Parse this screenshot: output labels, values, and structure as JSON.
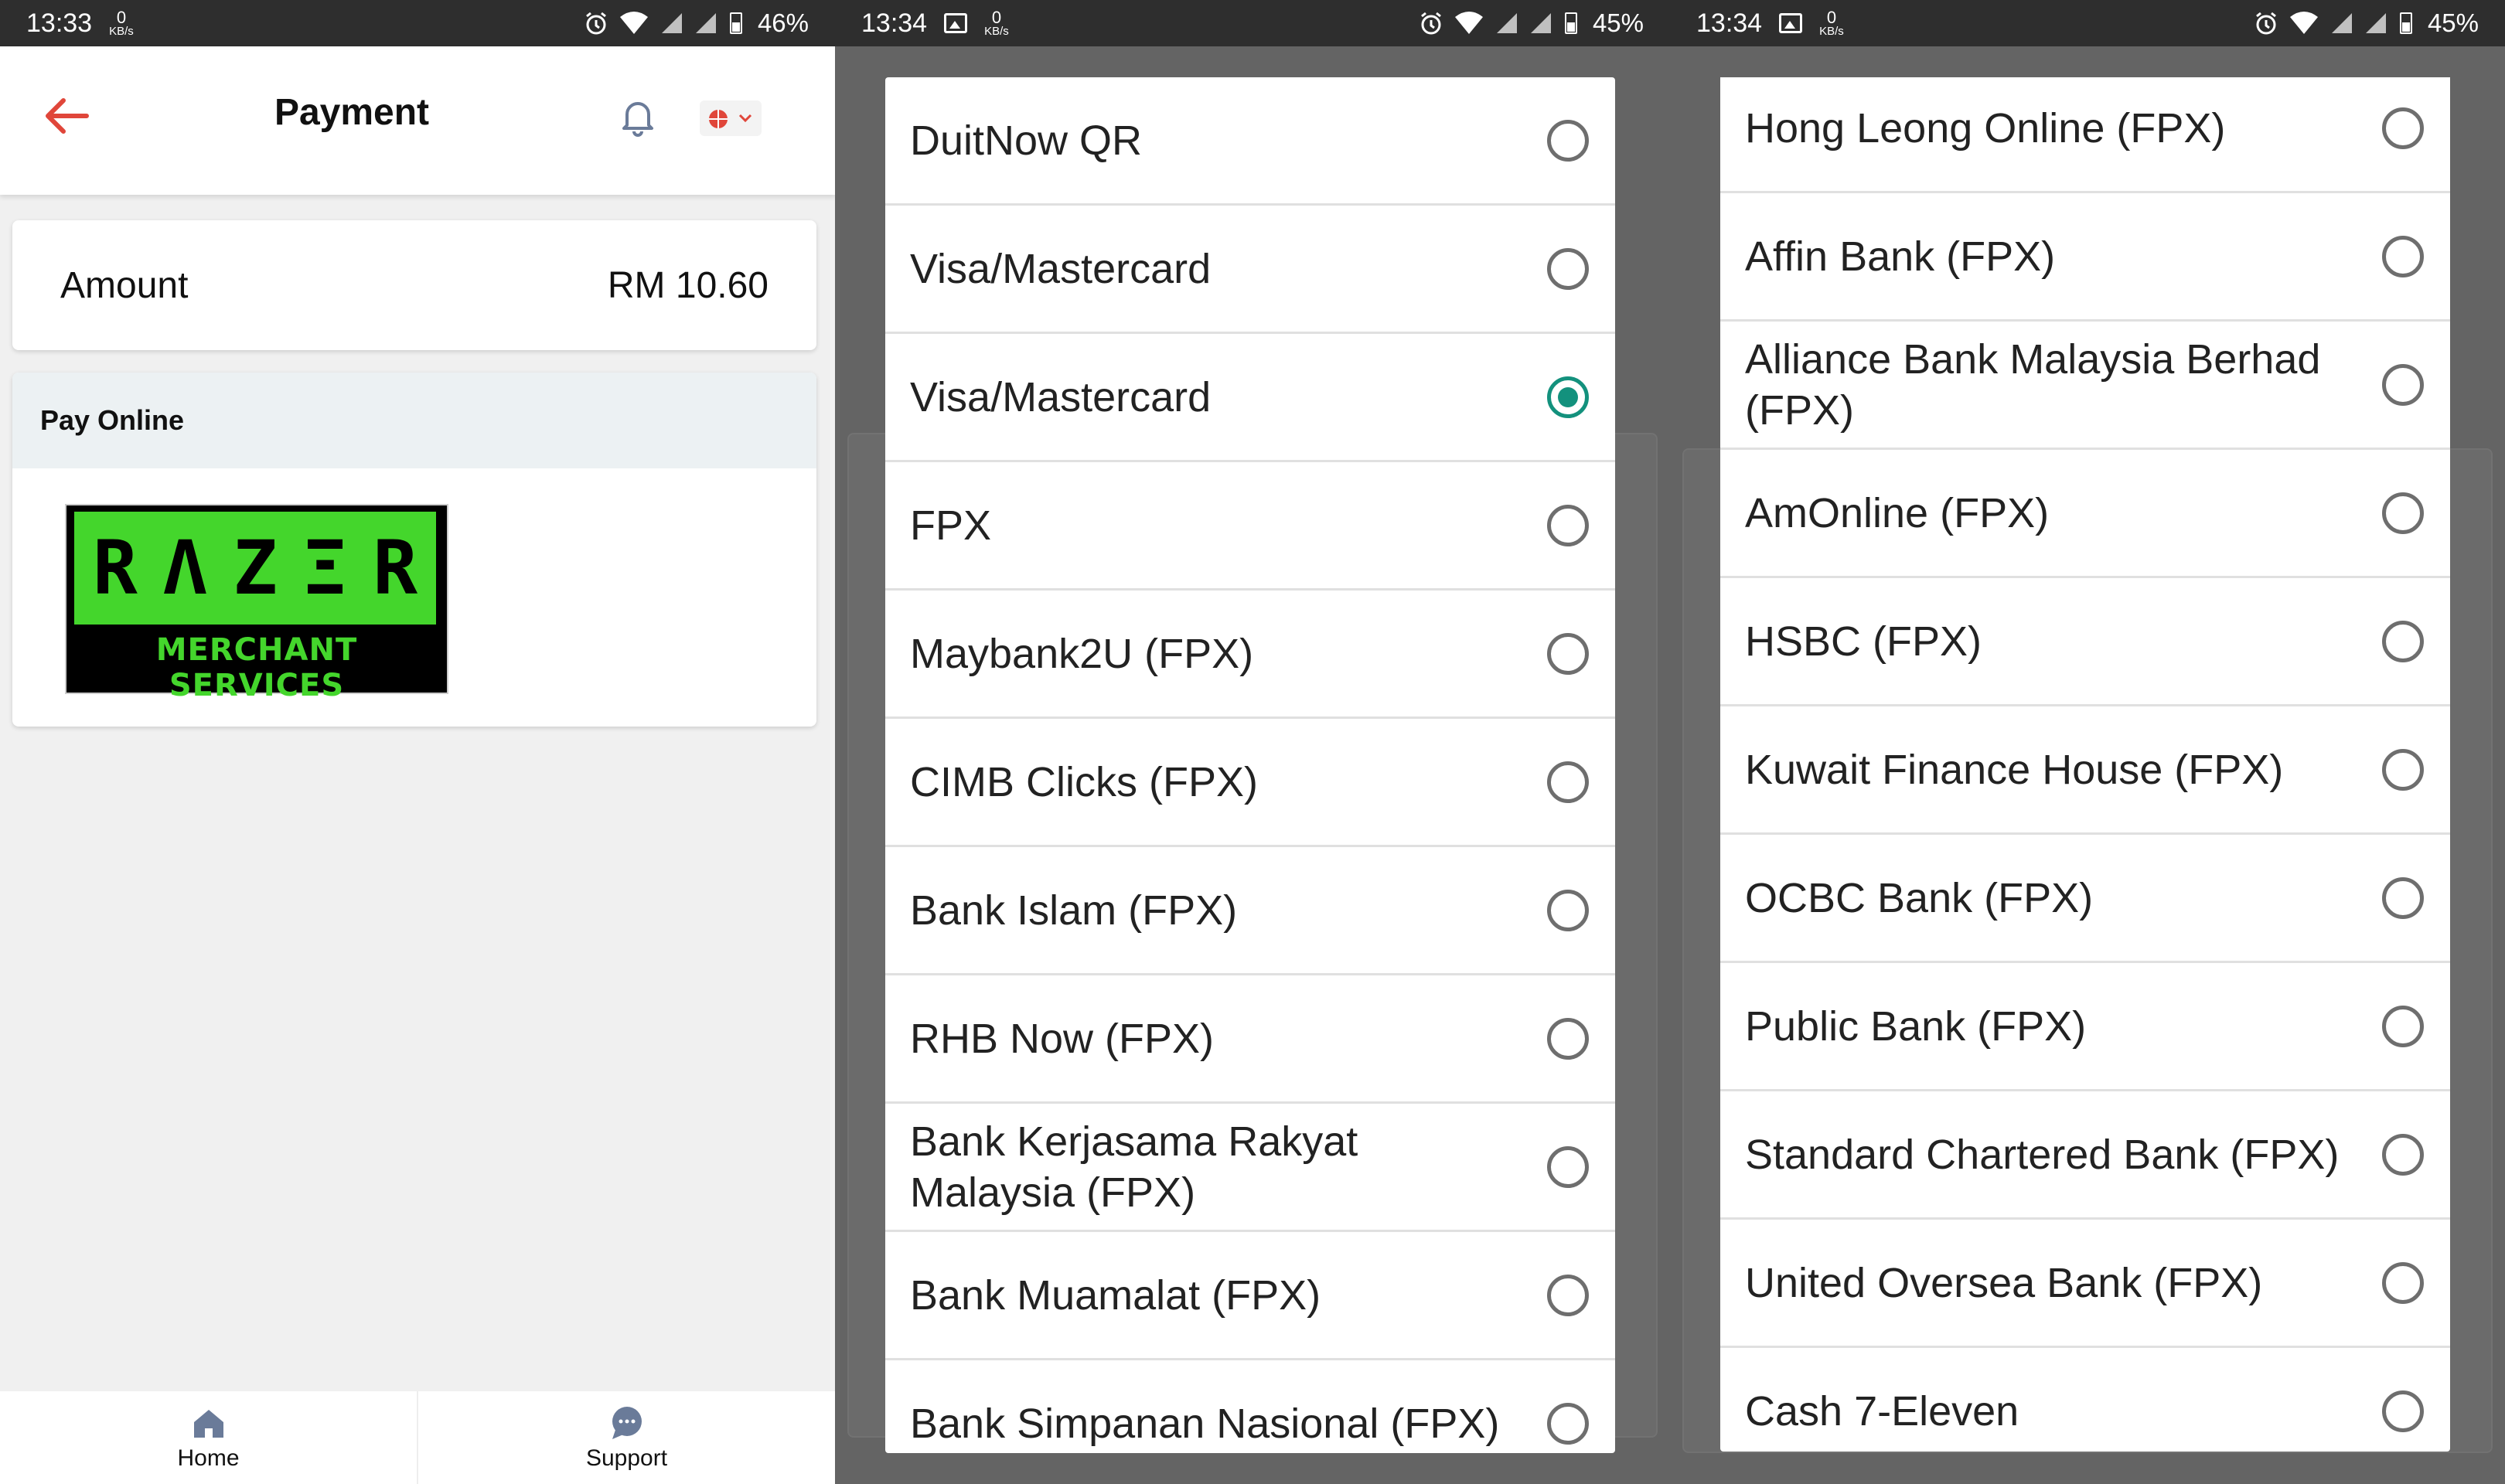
{
  "panels": {
    "left": {
      "status": {
        "time": "13:33",
        "net_value": "0",
        "net_unit": "KB/s",
        "battery": "46%"
      },
      "header": {
        "title": "Payment"
      },
      "amount": {
        "label": "Amount",
        "value": "RM 10.60"
      },
      "pay_online": {
        "title": "Pay Online",
        "logo_text": [
          "R",
          "Λ",
          "Z",
          "Ξ",
          "R"
        ],
        "logo_sub": "MERCHANT SERVICES"
      },
      "nav": {
        "home": "Home",
        "support": "Support"
      }
    },
    "middle": {
      "status": {
        "time": "13:34",
        "net_value": "0",
        "net_unit": "KB/s",
        "battery": "45%"
      },
      "options": [
        {
          "label": "DuitNow QR",
          "selected": false
        },
        {
          "label": "Visa/Mastercard",
          "selected": false
        },
        {
          "label": "Visa/Mastercard",
          "selected": true
        },
        {
          "label": "FPX",
          "selected": false
        },
        {
          "label": "Maybank2U (FPX)",
          "selected": false
        },
        {
          "label": "CIMB Clicks (FPX)",
          "selected": false
        },
        {
          "label": "Bank Islam (FPX)",
          "selected": false
        },
        {
          "label": "RHB Now (FPX)",
          "selected": false
        },
        {
          "label": "Bank Kerjasama Rakyat Malaysia (FPX)",
          "selected": false
        },
        {
          "label": "Bank Muamalat (FPX)",
          "selected": false
        },
        {
          "label": "Bank Simpanan Nasional (FPX)",
          "selected": false
        }
      ]
    },
    "right": {
      "status": {
        "time": "13:34",
        "net_value": "0",
        "net_unit": "KB/s",
        "battery": "45%"
      },
      "options": [
        {
          "label": "Hong Leong Online (FPX)",
          "selected": false
        },
        {
          "label": "Affin Bank (FPX)",
          "selected": false
        },
        {
          "label": "Alliance Bank Malaysia Berhad (FPX)",
          "selected": false
        },
        {
          "label": "AmOnline (FPX)",
          "selected": false
        },
        {
          "label": "HSBC (FPX)",
          "selected": false
        },
        {
          "label": "Kuwait Finance House (FPX)",
          "selected": false
        },
        {
          "label": "OCBC Bank (FPX)",
          "selected": false
        },
        {
          "label": "Public Bank (FPX)",
          "selected": false
        },
        {
          "label": "Standard Chartered Bank (FPX)",
          "selected": false
        },
        {
          "label": "United Oversea Bank (FPX)",
          "selected": false
        },
        {
          "label": "Cash 7-Eleven",
          "selected": false
        }
      ]
    }
  },
  "colors": {
    "accent": "#13917d",
    "back_arrow": "#e0463a",
    "razer_green": "#44d62c"
  },
  "icons": [
    "back-arrow-icon",
    "bell-icon",
    "globe-icon",
    "chevron-down-icon",
    "home-icon",
    "chat-bubble-icon",
    "alarm-icon",
    "wifi-icon",
    "signal-icon",
    "battery-icon",
    "gallery-icon"
  ]
}
